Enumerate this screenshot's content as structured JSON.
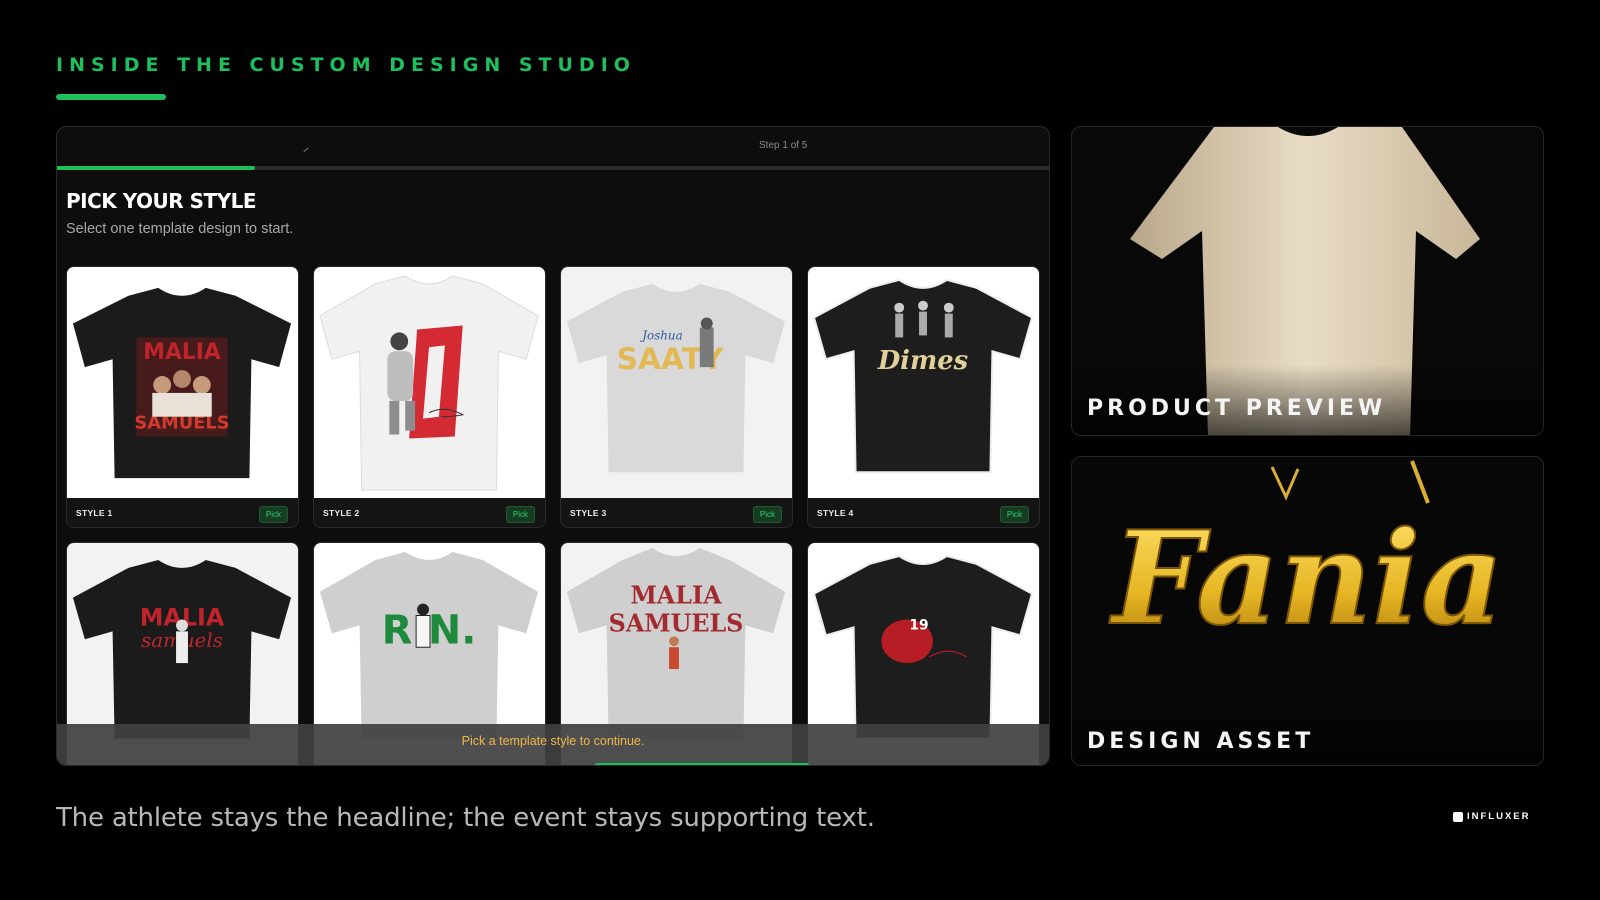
{
  "header": {
    "title": "INSIDE THE CUSTOM DESIGN STUDIO",
    "accent": "#1fbf5c"
  },
  "wizard": {
    "logo_glyph": "⸝",
    "step_text": "Step 1 of 5",
    "progress": 0.2,
    "title": "PICK YOUR STYLE",
    "subtitle": "Select one template design to start.",
    "styles": [
      {
        "label": "STYLE 1",
        "pick": "Pick",
        "tee": "black",
        "graphic": "MALIA SAMUELS",
        "graphic_color": "#c0242b"
      },
      {
        "label": "STYLE 2",
        "pick": "Pick",
        "tee": "white",
        "graphic": "0",
        "graphic_color": "#d42a33"
      },
      {
        "label": "STYLE 3",
        "pick": "Pick",
        "tee": "gray",
        "graphic": "SAATY",
        "graphic_color": "#e2b955"
      },
      {
        "label": "STYLE 4",
        "pick": "Pick",
        "tee": "black",
        "graphic": "Dimes",
        "graphic_color": "#e1d09a"
      },
      {
        "tee": "black",
        "graphic": "MALIA",
        "graphic2": "samuels",
        "graphic_color": "#c0242b"
      },
      {
        "tee": "gray",
        "graphic": "R.N.",
        "graphic_color": "#1e8a3c"
      },
      {
        "tee": "gray",
        "graphic": "MALIA",
        "graphic2": "SAMUELS",
        "graphic_color": "#a32a2f"
      },
      {
        "tee": "black",
        "graphic": "19",
        "graphic_color": "#b71d25"
      }
    ],
    "notice": "Pick a template style to continue."
  },
  "panels": {
    "preview_label": "PRODUCT PREVIEW",
    "asset_label": "DESIGN ASSET",
    "asset_word": "Fania"
  },
  "footer": {
    "caption": "The athlete stays the headline; the event stays supporting text.",
    "brand": "INFLUXER"
  }
}
